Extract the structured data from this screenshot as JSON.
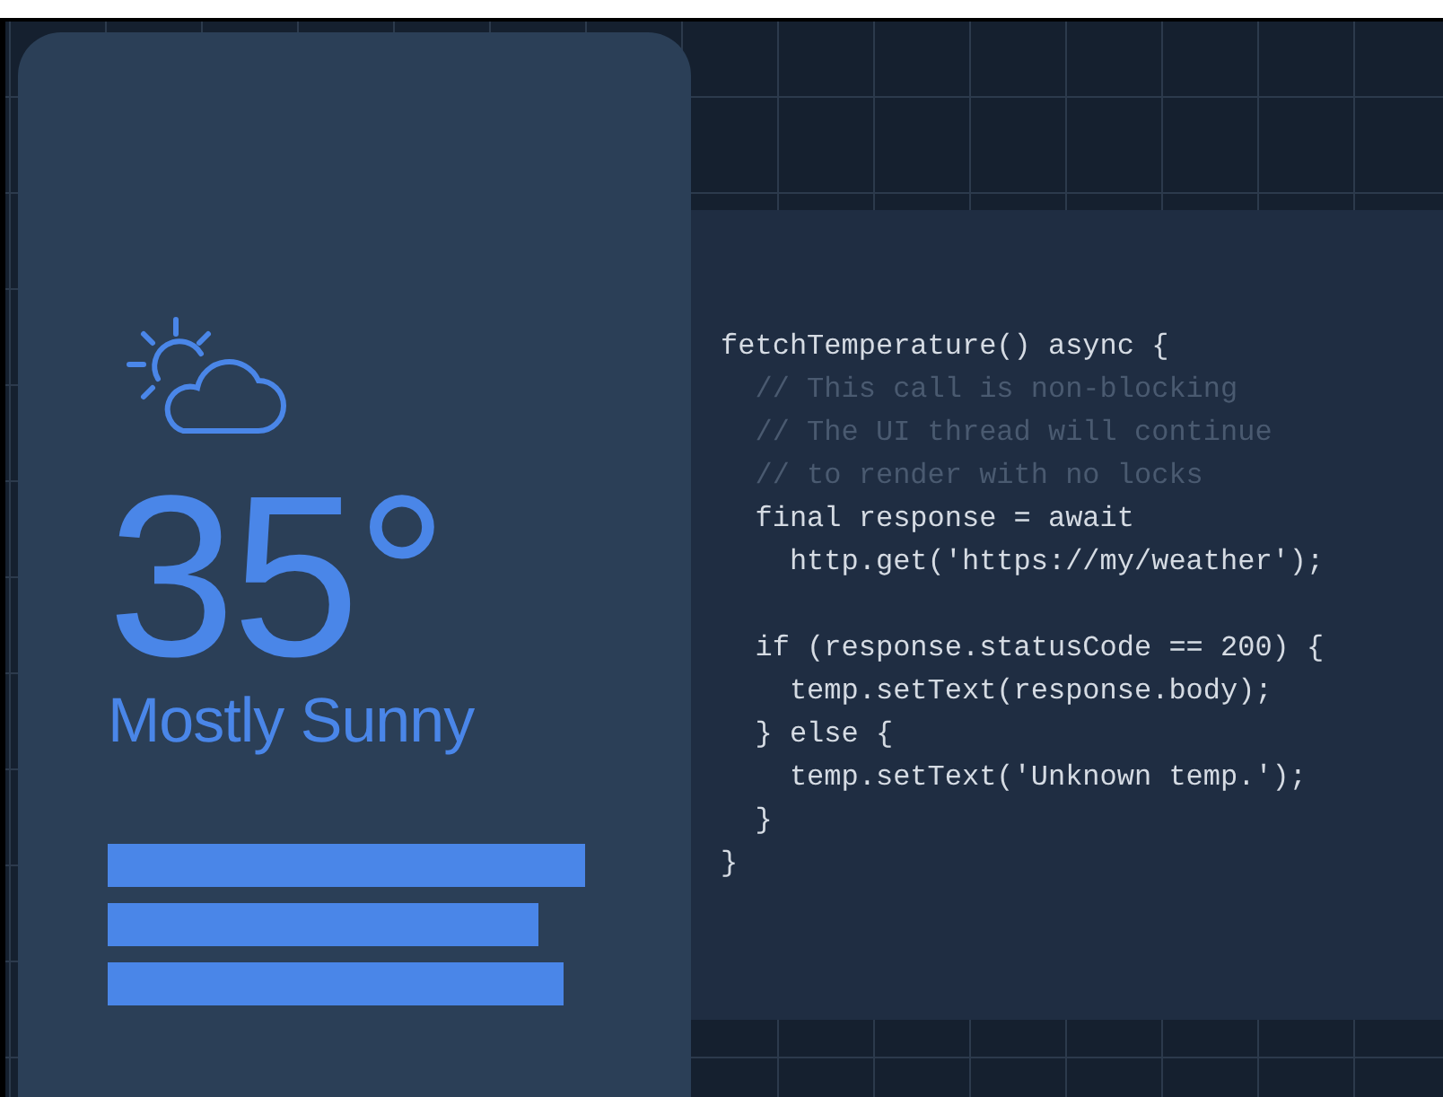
{
  "weather_card": {
    "temperature": "35°",
    "condition": "Mostly Sunny"
  },
  "code_panel": {
    "blocks": [
      {
        "lines": [
          {
            "text": "fetchTemperature() async {",
            "kind": "code"
          },
          {
            "text": "  // This call is non-blocking",
            "kind": "comment"
          },
          {
            "text": "  // The UI thread will continue",
            "kind": "comment"
          },
          {
            "text": "  // to render with no locks",
            "kind": "comment"
          },
          {
            "text": "  final response = await",
            "kind": "code"
          },
          {
            "text": "    http.get('https://my/weather');",
            "kind": "code"
          }
        ]
      },
      {
        "lines": [
          {
            "text": "  if (response.statusCode == 200) {",
            "kind": "code"
          },
          {
            "text": "    temp.setText(response.body);",
            "kind": "code"
          },
          {
            "text": "  } else {",
            "kind": "code"
          },
          {
            "text": "    temp.setText('Unknown temp.');",
            "kind": "code"
          },
          {
            "text": "  }",
            "kind": "code"
          },
          {
            "text": "}",
            "kind": "code"
          }
        ]
      }
    ]
  }
}
